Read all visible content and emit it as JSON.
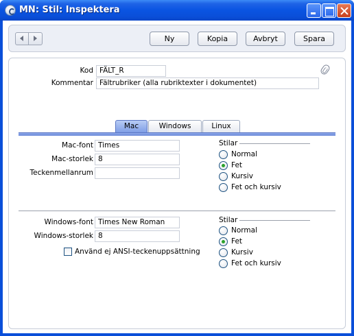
{
  "window": {
    "title": "MN: Stil: Inspektera"
  },
  "toolbar": {
    "buttons": [
      "Ny",
      "Kopia",
      "Avbryt",
      "Spara"
    ]
  },
  "header_fields": {
    "kod_label": "Kod",
    "kod_value": "FÄLT_R",
    "kommentar_label": "Kommentar",
    "kommentar_value": "Fältrubriker (alla rubriktexter i dokumentet)"
  },
  "tabs": [
    {
      "label": "Mac",
      "active": true
    },
    {
      "label": "Windows",
      "active": false
    },
    {
      "label": "Linux",
      "active": false
    }
  ],
  "mac": {
    "font_label": "Mac-font",
    "font_value": "Times",
    "size_label": "Mac-storlek",
    "size_value": "8",
    "spacing_label": "Teckenmellanrum",
    "spacing_value": "",
    "stilar_title": "Stilar",
    "styles": [
      {
        "label": "Normal",
        "checked": false
      },
      {
        "label": "Fet",
        "checked": true
      },
      {
        "label": "Kursiv",
        "checked": false
      },
      {
        "label": "Fet och kursiv",
        "checked": false
      }
    ]
  },
  "windows": {
    "font_label": "Windows-font",
    "font_value": "Times New Roman",
    "size_label": "Windows-storlek",
    "size_value": "8",
    "ansi_label": "Använd ej ANSI-teckenuppsättning",
    "ansi_checked": false,
    "stilar_title": "Stilar",
    "styles": [
      {
        "label": "Normal",
        "checked": false
      },
      {
        "label": "Fet",
        "checked": true
      },
      {
        "label": "Kursiv",
        "checked": false
      },
      {
        "label": "Fet och kursiv",
        "checked": false
      }
    ]
  }
}
